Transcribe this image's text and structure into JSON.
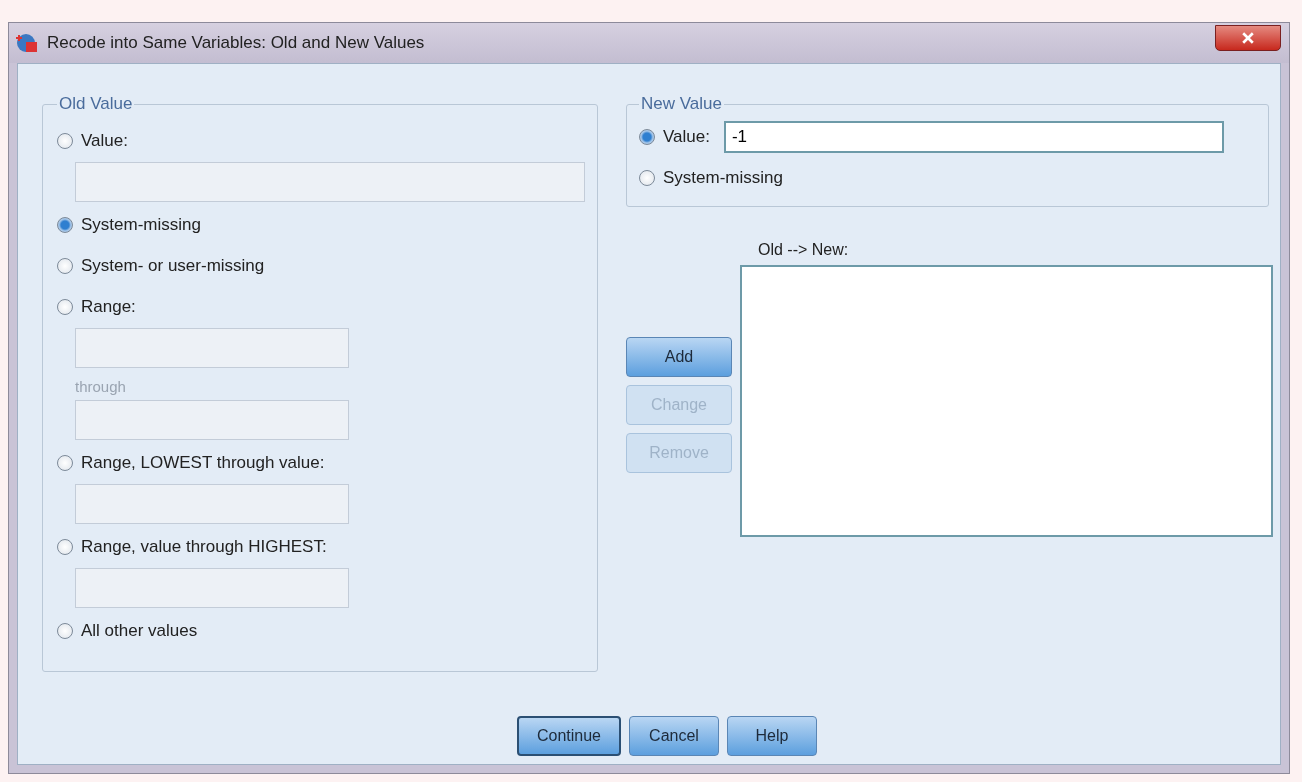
{
  "window": {
    "title": "Recode into Same Variables: Old and New Values"
  },
  "old_value": {
    "title": "Old Value",
    "items": [
      {
        "kind": "radio",
        "label": "Value:",
        "selected": false
      },
      {
        "kind": "wide_field",
        "disabled": true
      },
      {
        "kind": "radio",
        "label": "System-missing",
        "selected": true
      },
      {
        "kind": "radio",
        "label": "System- or user-missing",
        "selected": false
      },
      {
        "kind": "radio",
        "label": "Range:",
        "selected": false
      },
      {
        "kind": "field",
        "disabled": true
      },
      {
        "kind": "label",
        "label": "through",
        "disabled": true
      },
      {
        "kind": "field",
        "disabled": true
      },
      {
        "kind": "radio",
        "label": "Range, LOWEST through value:",
        "selected": false
      },
      {
        "kind": "field",
        "disabled": true
      },
      {
        "kind": "radio",
        "label": "Range, value through HIGHEST:",
        "selected": false
      },
      {
        "kind": "field",
        "disabled": true
      },
      {
        "kind": "radio",
        "label": "All other values",
        "selected": false
      }
    ]
  },
  "new_value": {
    "title": "New Value",
    "value_option": {
      "label": "Value:",
      "selected": true,
      "value": "-1"
    },
    "missing_option": {
      "label": "System-missing",
      "selected": false
    }
  },
  "mapping": {
    "label": "Old --> New:",
    "buttons": [
      {
        "label": "Add",
        "disabled": false
      },
      {
        "label": "Change",
        "disabled": true
      },
      {
        "label": "Remove",
        "disabled": true
      }
    ]
  },
  "buttons": [
    {
      "label": "Continue",
      "default": true
    },
    {
      "label": "Cancel",
      "default": false
    },
    {
      "label": "Help",
      "default": false
    }
  ]
}
